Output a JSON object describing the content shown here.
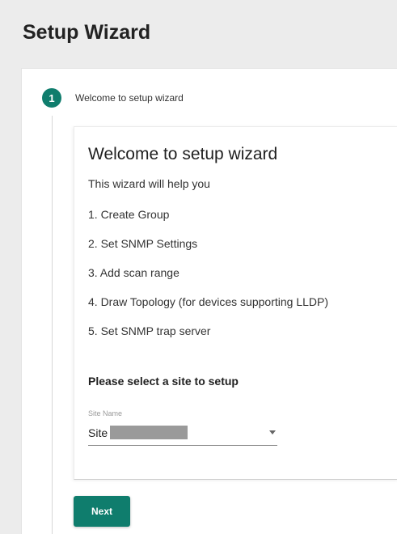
{
  "page": {
    "title": "Setup Wizard"
  },
  "stepper": {
    "step_number": "1",
    "step_label": "Welcome to setup wizard"
  },
  "welcome": {
    "title": "Welcome to setup wizard",
    "subtitle": "This wizard will help you",
    "steps": [
      "1. Create Group",
      "2. Set SNMP Settings",
      "3. Add scan range",
      "4. Draw Topology (for devices supporting LLDP)",
      "5. Set SNMP trap server"
    ]
  },
  "site_select": {
    "heading": "Please select a site to setup",
    "field_label": "Site Name",
    "value": "Site",
    "value_redacted": true
  },
  "actions": {
    "next_label": "Next"
  },
  "colors": {
    "accent": "#0f7d6d",
    "background": "#ececec",
    "card": "#ffffff"
  },
  "icons": {
    "dropdown": "chevron-down-icon"
  }
}
